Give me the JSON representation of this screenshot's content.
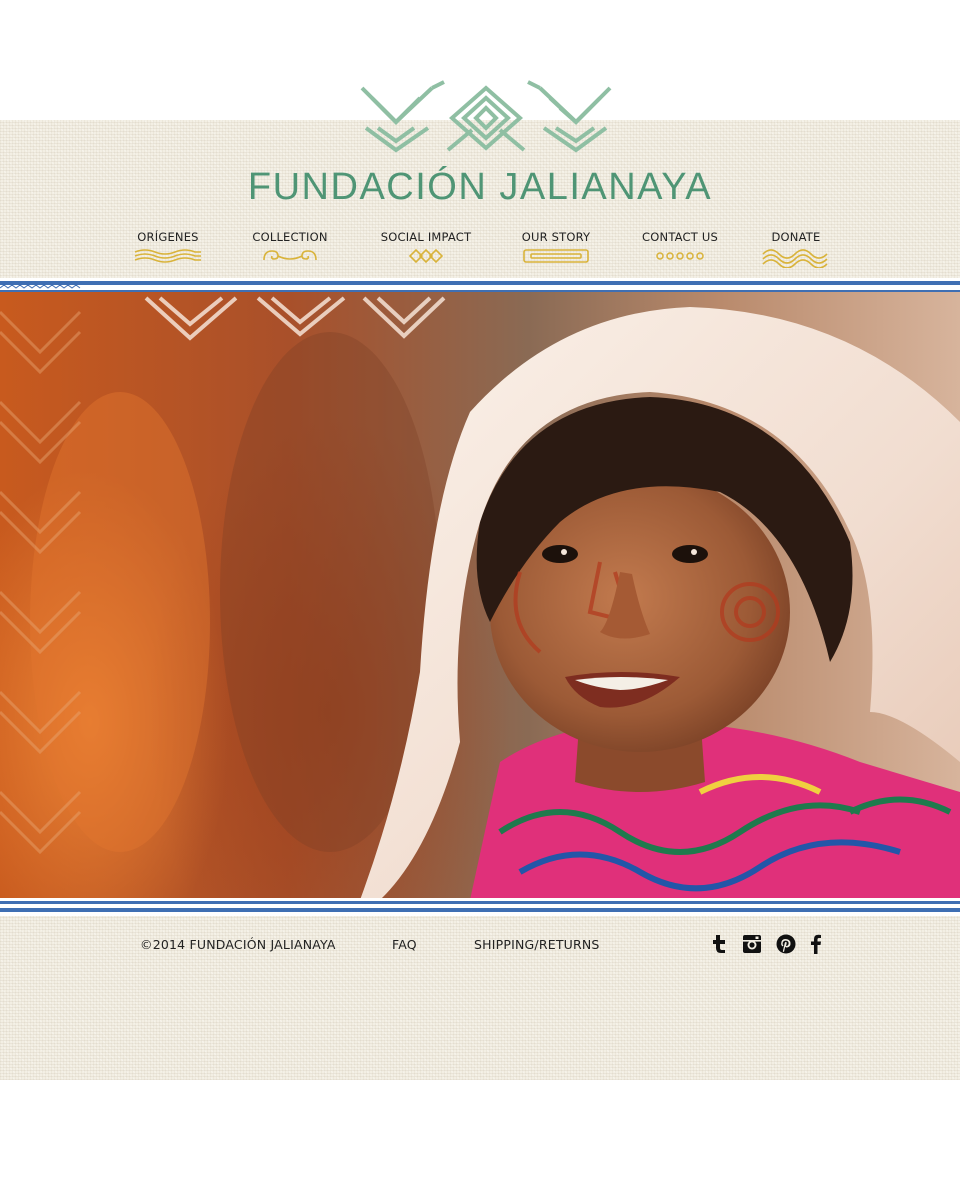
{
  "brand": {
    "name": "FUNDACIÓN JALIANAYA"
  },
  "nav": {
    "items": [
      {
        "label": "ORÍGENES"
      },
      {
        "label": "COLLECTION"
      },
      {
        "label": "SOCIAL IMPACT"
      },
      {
        "label": "OUR STORY"
      },
      {
        "label": "CONTACT US"
      },
      {
        "label": "DONATE"
      }
    ]
  },
  "footer": {
    "copyright": "©2014 FUNDACIÓN JALIANAYA",
    "faq": "FAQ",
    "shipping": "SHIPPING/RETURNS",
    "social": [
      {
        "icon": "tumblr-icon"
      },
      {
        "icon": "instagram-icon"
      },
      {
        "icon": "pinterest-icon"
      },
      {
        "icon": "facebook-icon"
      }
    ]
  },
  "colors": {
    "brand_green": "#4f9575",
    "logo_green": "#8fbfa3",
    "ornament_gold": "#d9b33a",
    "stripe_blue": "#3f6fb3",
    "paper": "#f3efe4"
  }
}
